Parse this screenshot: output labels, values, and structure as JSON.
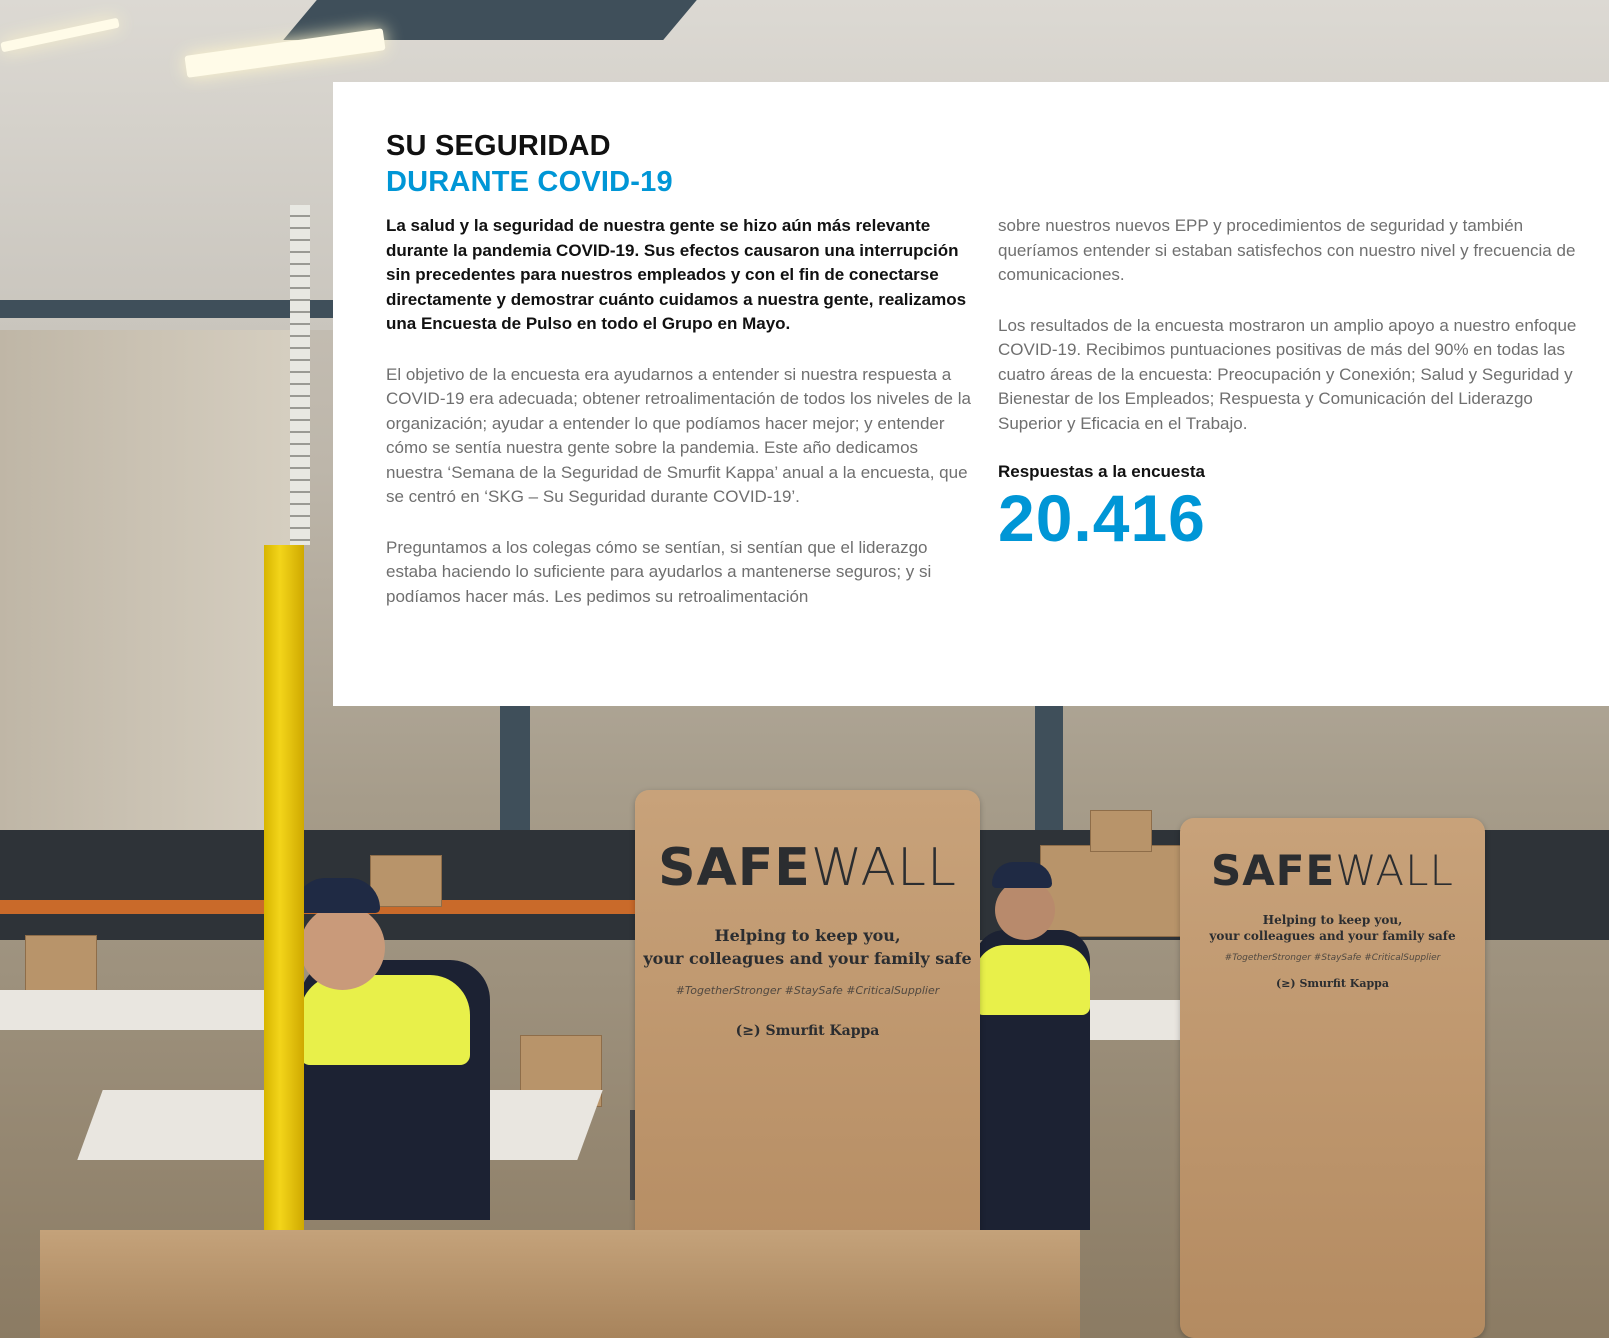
{
  "article": {
    "title_line1": "SU SEGURIDAD",
    "title_line2": "DURANTE COVID-19",
    "lead": "La salud y la seguridad de nuestra gente se hizo aún más relevante durante la pandemia COVID-19. Sus efectos causaron una interrupción sin precedentes para nuestros empleados y con el fin de conectarse directamente y demostrar cuánto cuidamos a nuestra gente, realizamos una Encuesta de Pulso en todo el Grupo en Mayo.",
    "para1": "El objetivo de la encuesta era ayudarnos a entender si nuestra respuesta a COVID-19 era adecuada; obtener retroalimentación de todos los niveles de la organización; ayudar a entender lo que podíamos hacer mejor; y entender cómo se sentía nuestra gente sobre la pandemia. Este año dedicamos nuestra ‘Semana de la Seguridad de Smurfit Kappa’ anual a la encuesta, que se centró en ‘SKG – Su Seguridad durante COVID-19’.",
    "para2": "Preguntamos a los colegas cómo se sentían, si sentían que el liderazgo estaba haciendo lo suficiente para ayudarlos a mantenerse seguros; y si podíamos hacer más. Les pedimos su retroalimentación",
    "para3": "sobre nuestros nuevos EPP y procedimientos de seguridad y también queríamos entender si estaban satisfechos con nuestro nivel y frecuencia de comunicaciones.",
    "para4": "Los resultados de la encuesta mostraron un amplio apoyo a nuestro enfoque COVID-19. Recibimos puntuaciones positivas de más del 90% en todas las cuatro áreas de la encuesta: Preocupación y Conexión; Salud y Seguridad y Bienestar de los Empleados; Respuesta y Comunicación del Liderazgo Superior y Eficacia en el Trabajo.",
    "stat_label": "Respuestas a la encuesta",
    "stat_value": "20.416"
  },
  "photo": {
    "sign_brand_bold": "SAFE",
    "sign_brand_light": "WALL",
    "sign_tagline_1": "Helping to keep you,",
    "sign_tagline_2": "your colleagues and your family safe",
    "sign_hashtags": "#TogetherStronger #StaySafe #CriticalSupplier",
    "sign_logo": "(≥) Smurfit Kappa"
  },
  "colors": {
    "accent_blue": "#0096d6",
    "heading_black": "#111111",
    "body_grey": "#6f6f6f"
  }
}
